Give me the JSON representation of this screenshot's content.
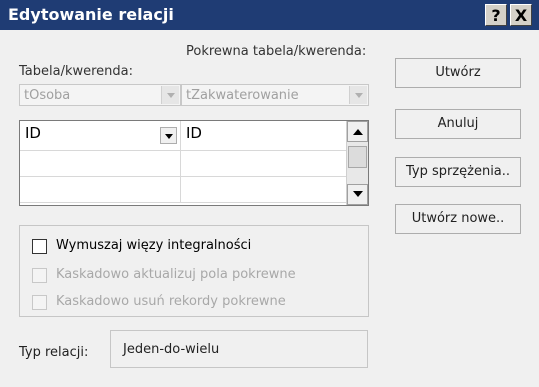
{
  "window": {
    "title": "Edytowanie relacji",
    "help_label": "?",
    "close_label": "X"
  },
  "left_table": {
    "label": "Tabela/kwerenda:",
    "value": "tOsoba"
  },
  "right_table": {
    "label": "Pokrewna tabela/kwerenda:",
    "value": "tZakwaterowanie"
  },
  "fields_grid": {
    "rows": [
      {
        "left": "ID",
        "right": "ID"
      },
      {
        "left": "",
        "right": ""
      },
      {
        "left": "",
        "right": ""
      }
    ]
  },
  "buttons": {
    "create": "Utwórz",
    "cancel": "Anuluj",
    "join_type": "Typ sprzężenia..",
    "create_new": "Utwórz nowe.."
  },
  "options": {
    "enforce_integrity": "Wymuszaj więzy integralności",
    "cascade_update": "Kaskadowo aktualizuj pola pokrewne",
    "cascade_delete": "Kaskadowo usuń rekordy pokrewne"
  },
  "relationship": {
    "label": "Typ relacji:",
    "value": "Jeden-do-wielu"
  }
}
